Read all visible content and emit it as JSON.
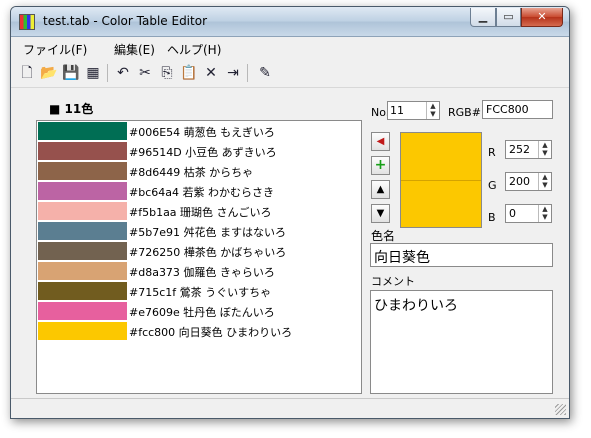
{
  "window": {
    "title": "test.tab - Color Table Editor"
  },
  "menu": {
    "file": "ファイル(F)",
    "edit": "編集(E)",
    "help": "ヘルプ(H)"
  },
  "toolbar": {
    "icons": [
      "new-file-icon",
      "open-folder-icon",
      "save-icon",
      "palette-icon",
      "undo-icon",
      "cut-icon",
      "copy-icon",
      "paste-icon",
      "delete-icon",
      "export-icon",
      "eyedropper-icon"
    ]
  },
  "list": {
    "count_label": "■ 11色",
    "rows": [
      {
        "color": "#006E54",
        "text": "#006E54 萌葱色 もえぎいろ"
      },
      {
        "color": "#96514D",
        "text": "#96514D 小豆色 あずきいろ"
      },
      {
        "color": "#8d6449",
        "text": "#8d6449 枯茶 からちゃ"
      },
      {
        "color": "#bc64a4",
        "text": "#bc64a4 若紫 わかむらさき"
      },
      {
        "color": "#f5b1aa",
        "text": "#f5b1aa 珊瑚色 さんごいろ"
      },
      {
        "color": "#5b7e91",
        "text": "#5b7e91 舛花色 ますはないろ"
      },
      {
        "color": "#726250",
        "text": "#726250 樺茶色 かばちゃいろ"
      },
      {
        "color": "#d8a373",
        "text": "#d8a373 伽羅色 きゃらいろ"
      },
      {
        "color": "#715c1f",
        "text": "#715c1f 鶯茶 うぐいすちゃ"
      },
      {
        "color": "#e7609e",
        "text": "#e7609e 牡丹色 ぼたんいろ"
      },
      {
        "color": "#fcc800",
        "text": "#fcc800 向日葵色 ひまわりいろ"
      }
    ]
  },
  "editor": {
    "no_label": "No.",
    "no_value": "11",
    "rgb_label": "RGB#",
    "rgb_value": "FCC800",
    "preview_color": "#fcc800",
    "r_label": "R",
    "r_value": "252",
    "g_label": "G",
    "g_value": "200",
    "b_label": "B",
    "b_value": "0",
    "name_label": "色名",
    "name_value": "向日葵色",
    "comment_label": "コメント",
    "comment_value": "ひまわりいろ"
  }
}
